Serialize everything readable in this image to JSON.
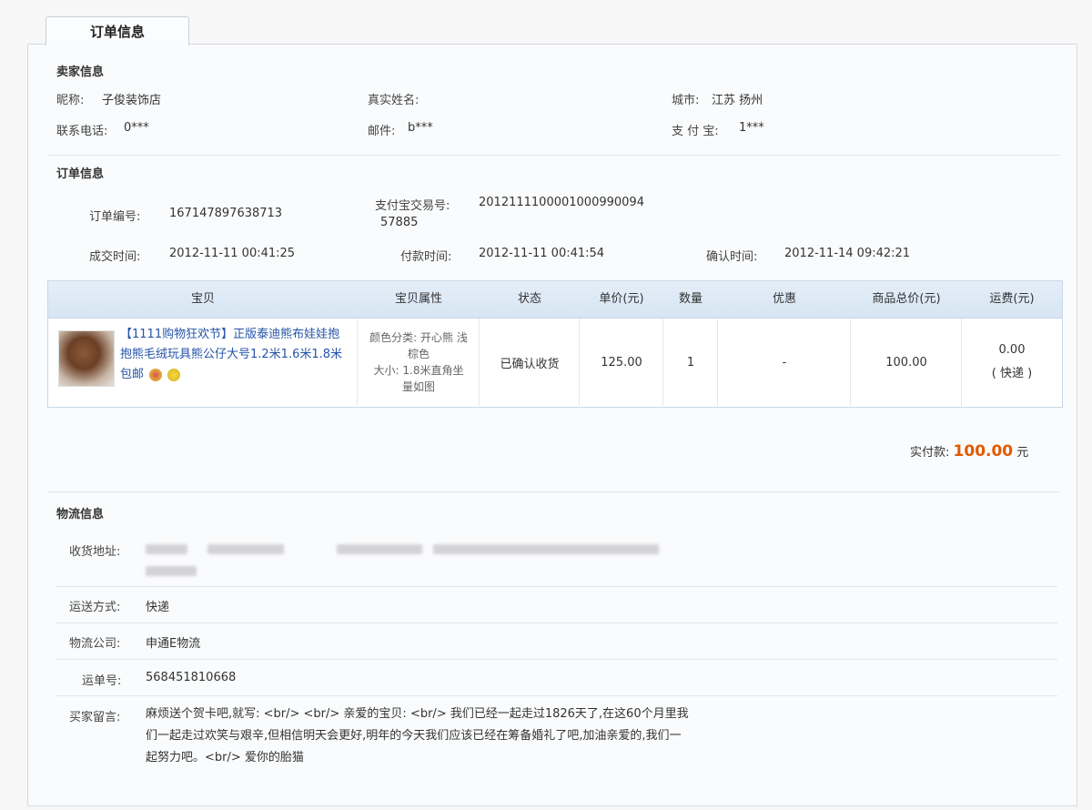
{
  "tab": {
    "label": "订单信息"
  },
  "seller": {
    "title": "卖家信息",
    "nickname_label": "昵称:",
    "nickname": "子俊装饰店",
    "realname_label": "真实姓名:",
    "city_label": "城市:",
    "city": "江苏 扬州",
    "phone_label": "联系电话:",
    "phone": "0***",
    "email_label": "邮件:",
    "email": "b***",
    "alipay_label": "支 付 宝:",
    "alipay": "1***"
  },
  "order": {
    "title": "订单信息",
    "number_label": "订单编号:",
    "number": "167147897638713",
    "trade_label": "支付宝交易号:",
    "trade_line1": "2012111100001000990094",
    "trade_line2": "57885",
    "deal_time_label": "成交时间:",
    "deal_time": "2012-11-11 00:41:25",
    "pay_time_label": "付款时间:",
    "pay_time": "2012-11-11 00:41:54",
    "confirm_time_label": "确认时间:",
    "confirm_time": "2012-11-14 09:42:21"
  },
  "goods": {
    "headers": [
      "宝贝",
      "宝贝属性",
      "状态",
      "单价(元)",
      "数量",
      "优惠",
      "商品总价(元)",
      "运费(元)"
    ],
    "item_title": "【1111购物狂欢节】正版泰迪熊布娃娃抱抱熊毛绒玩具熊公仔大号1.2米1.6米1.8米 包邮",
    "attr_line1": "颜色分类: 开心熊 浅棕色",
    "attr_line2": "大小: 1.8米直角坐量如图",
    "status": "已确认收货",
    "price": "125.00",
    "qty": "1",
    "discount": "-",
    "total": "100.00",
    "shipping_fee": "0.00",
    "shipping_method": "( 快递 )"
  },
  "payment": {
    "label": "实付款:",
    "amount": "100.00",
    "unit": "元"
  },
  "logistics": {
    "title": "物流信息",
    "address_label": "收货地址:",
    "method_label": "运送方式:",
    "method": "快递",
    "company_label": "物流公司:",
    "company": "申通E物流",
    "waybill_label": "运单号:",
    "waybill": "568451810668",
    "memo_label": "买家留言:",
    "memo": "麻烦送个贺卡吧,就写: <br/> <br/> 亲爱的宝贝: <br/> 我们已经一起走过1826天了,在这60个月里我们一起走过欢笑与艰辛,但相信明天会更好,明年的今天我们应该已经在筹备婚礼了吧,加油亲爱的,我们一起努力吧。<br/> 爱你的胎猫"
  }
}
